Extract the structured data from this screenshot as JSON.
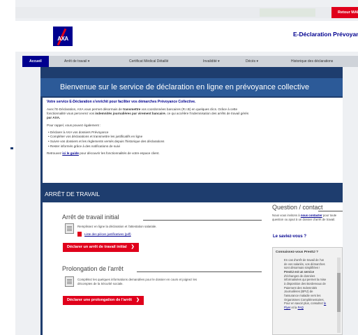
{
  "topbar": {
    "return_button": "Retour MAP"
  },
  "header": {
    "logo_text": "AXA",
    "app_title": "E-Déclaration Prévoyance"
  },
  "nav": {
    "tabs": [
      {
        "label": "Accueil"
      },
      {
        "label": "Arrêt de travail  ▾"
      },
      {
        "label": "Certificat Médical Détaillé"
      },
      {
        "label": "Invalidité  ▾"
      },
      {
        "label": "Décès  ▾"
      },
      {
        "label": "Historique des déclarations"
      }
    ]
  },
  "hero": {
    "title": "Bienvenue sur le service de déclaration en ligne en prévoyance collective"
  },
  "intro": {
    "lead": "Votre service E-Déclaration s'enrichit pour faciliter vos démarches Prévoyance Collective.",
    "p1_a": "Avec l'E-Déclaration, AXA vous permet désormais de ",
    "p1_b": "transmettre",
    "p1_c": " vos coordonnées bancaires (R.I.B) en quelques clics. Grâce à cette",
    "p1_line2_a": "fonctionnalité vous percevrez vos ",
    "p1_line2_b": "indemnités journalières par virement bancaire",
    "p1_line2_c": ", ce qui accélère l'indemnisation des arrêts de travail gérés",
    "p1_line3": "par AXA.",
    "p2": "Pour rappel, vous pouvez également :",
    "bullets": [
      "Déclarer à AXA vos dossiers Prévoyance",
      "Compléter vos déclarations et transmettre les justificatifs en ligne",
      "Suivre vos dossiers et les règlements versés depuis l'historique des déclarations",
      "Rester informés grâce à des notifications de suivi"
    ],
    "guide_a": "Retrouvez ",
    "guide_link": "ici le guide",
    "guide_b": " pour découvrir les fonctionnalités de votre espace client."
  },
  "section": {
    "title": "ARRÊT DE TRAVAIL"
  },
  "initial": {
    "title": "Arrêt de travail initial",
    "text": "Remplissez en ligne la déclaration et l'attestation salariale.",
    "pdf_link": "Liste des pièces justificatives (pdf)",
    "button": "Déclarer un arrêt de travail initial",
    "arrow": "❯"
  },
  "prolongation": {
    "title": "Prolongation de l'arrêt",
    "text_line1": "Complétez les quelques informations demandées pour le dossier en cours et joignez les",
    "text_line2": "décomptes de la Sécurité sociale.",
    "button": "Déclarer une prolongation de l'arrêt",
    "arrow": "❯"
  },
  "question": {
    "title": "Question / contact",
    "text_a": "Nous vous invitons à ",
    "text_link": "nous contacter",
    "text_b": " pour toute",
    "text_line2": "question ou ajout à un dossier d'arrêt de travail."
  },
  "saviez": {
    "title": "Le saviez-vous ?"
  },
  "prestij": {
    "title": "Connaissez-vous PrestIJ ?",
    "lines": [
      "En cas d'arrêt de travail de l'un",
      "de vos salariés, vos démarches",
      "sont désormais simplifiées !",
      "PrestIJ est un service",
      "d'échanges de données",
      "informatisées qui permet la mise",
      "à disposition des Bordereaux de",
      "Paiement des Indemnités",
      "Journalières (BPIJ) de",
      "l'assurance maladie vers les",
      "Organismes Complémentaires."
    ],
    "last_line_a": "Pour en savoir plus, consultez ",
    "last_line_link": "le",
    "faq_line_a": "Flyer",
    "faq_line_b": " et la ",
    "faq_link": "FAQ"
  },
  "colors": {
    "axa_blue": "#00008f",
    "axa_red": "#e0001b",
    "band_blue": "#1e3d6e",
    "hero_blue": "#2c5a98"
  }
}
